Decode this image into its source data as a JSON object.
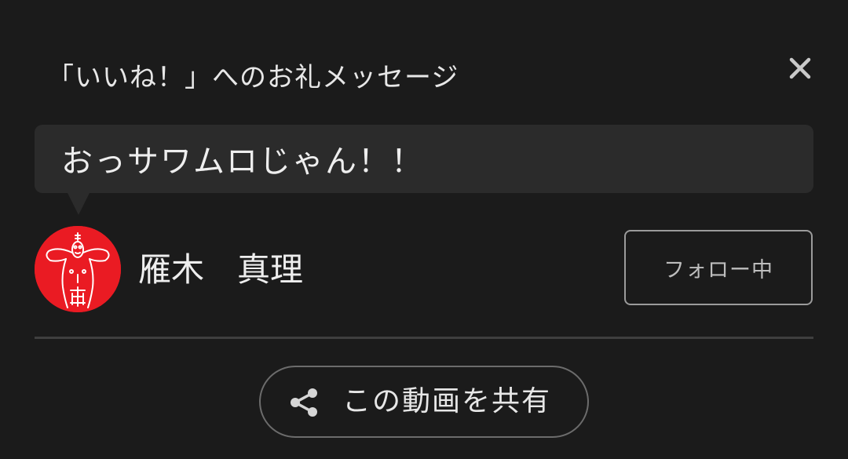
{
  "dialog": {
    "title": "「いいね！」へのお礼メッセージ",
    "close_icon": "close-icon",
    "message": "おっサワムロじゃん！！"
  },
  "user": {
    "name": "雁木　真理",
    "avatar_icon": "avatar",
    "avatar_color": "#ea1b23",
    "follow_label": "フォロー中"
  },
  "share": {
    "icon": "share-icon",
    "label": "この動画を共有"
  },
  "colors": {
    "background": "#1b1b1b",
    "bubble": "#2b2b2b",
    "text": "#e7e7e7",
    "border": "#9b9b9b"
  }
}
